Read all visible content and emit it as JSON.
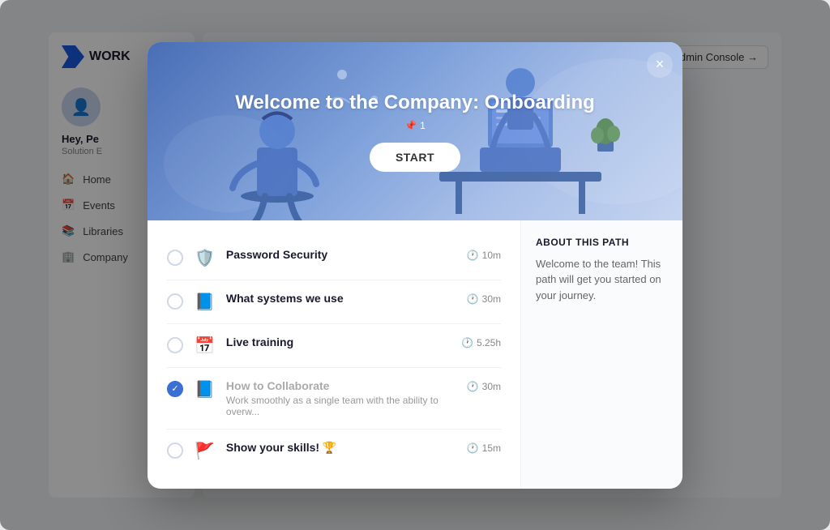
{
  "app": {
    "logo": "WORK",
    "sidebar": {
      "user": {
        "name": "Hey, Pe",
        "role": "Solution E"
      },
      "nav": [
        {
          "id": "home",
          "label": "Home",
          "icon": "🏠"
        },
        {
          "id": "events",
          "label": "Events",
          "icon": "📅"
        },
        {
          "id": "libraries",
          "label": "Libraries",
          "icon": "📚"
        },
        {
          "id": "company",
          "label": "Company",
          "icon": "🏢"
        }
      ]
    },
    "topbar": {
      "admin_link": "Admin Console →"
    }
  },
  "modal": {
    "close_label": "×",
    "hero": {
      "title": "Welcome to the Company: Onboarding",
      "badge": "1",
      "start_btn": "START"
    },
    "courses": [
      {
        "id": "password-security",
        "icon": "🛡️",
        "title": "Password Security",
        "duration": "10m",
        "completed": false,
        "description": ""
      },
      {
        "id": "what-systems",
        "icon": "📘",
        "title": "What systems we use",
        "duration": "30m",
        "completed": false,
        "description": ""
      },
      {
        "id": "live-training",
        "icon": "📅",
        "title": "Live training",
        "duration": "5.25h",
        "completed": false,
        "description": ""
      },
      {
        "id": "how-to-collaborate",
        "icon": "📘",
        "title": "How to Collaborate",
        "duration": "30m",
        "completed": true,
        "description": "Work smoothly as a single team with the ability to overw..."
      },
      {
        "id": "show-skills",
        "icon": "🚩",
        "title": "Show your skills! 🏆",
        "duration": "15m",
        "completed": false,
        "description": ""
      }
    ],
    "about": {
      "title": "ABOUT THIS PATH",
      "text": "Welcome to the team! This path will get you started on your journey."
    }
  }
}
